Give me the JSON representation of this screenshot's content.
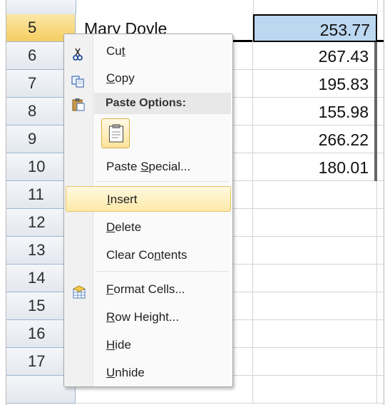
{
  "rows": [
    {
      "header": "5",
      "name": "Mary Doyle",
      "value": "253.77"
    },
    {
      "header": "6",
      "name": "",
      "value": "267.43"
    },
    {
      "header": "7",
      "name": "",
      "value": "195.83"
    },
    {
      "header": "8",
      "name": "",
      "value": "155.98"
    },
    {
      "header": "9",
      "name": "",
      "value": "266.22"
    },
    {
      "header": "10",
      "name": "",
      "value": "180.01"
    },
    {
      "header": "11",
      "name": "",
      "value": ""
    },
    {
      "header": "12",
      "name": "",
      "value": ""
    },
    {
      "header": "13",
      "name": "",
      "value": ""
    },
    {
      "header": "14",
      "name": "",
      "value": ""
    },
    {
      "header": "15",
      "name": "",
      "value": ""
    },
    {
      "header": "16",
      "name": "",
      "value": ""
    },
    {
      "header": "17",
      "name": "",
      "value": ""
    }
  ],
  "menu": {
    "cut": {
      "pre": "Cu",
      "key": "t",
      "post": "",
      "icon": "scissors-icon"
    },
    "copy": {
      "pre": "",
      "key": "C",
      "post": "opy",
      "icon": "copy-icon"
    },
    "paste_options": {
      "label": "Paste Options:",
      "icon": "clipboard-icon"
    },
    "paste_special": {
      "pre": "Paste ",
      "key": "S",
      "post": "pecial...",
      "icon": "paste-icon"
    },
    "insert": {
      "pre": "",
      "key": "I",
      "post": "nsert"
    },
    "delete": {
      "pre": "",
      "key": "D",
      "post": "elete"
    },
    "clear_contents": {
      "pre": "Clear Co",
      "key": "n",
      "post": "tents"
    },
    "format_cells": {
      "pre": "",
      "key": "F",
      "post": "ormat Cells...",
      "icon": "format-cells-icon"
    },
    "row_height": {
      "pre": "",
      "key": "R",
      "post": "ow Height..."
    },
    "hide": {
      "pre": "",
      "key": "H",
      "post": "ide"
    },
    "unhide": {
      "pre": "",
      "key": "U",
      "post": "nhide"
    }
  },
  "colors": {
    "selection_fill": "#bcd7f0",
    "selected_header": "#f5cd61",
    "menu_highlight": "#fde9a8"
  }
}
